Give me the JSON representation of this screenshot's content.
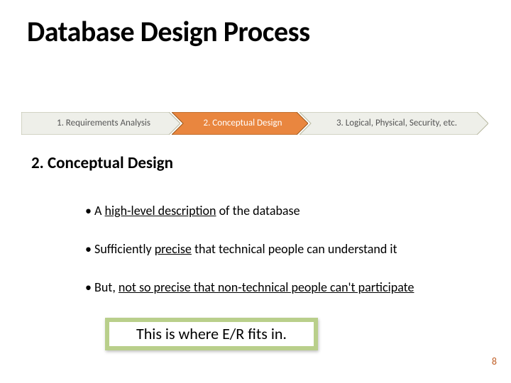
{
  "title": "Database Design Process",
  "chevrons": {
    "step1": "1. Requirements Analysis",
    "step2": "2. Conceptual Design",
    "step3": "3. Logical, Physical, Security, etc."
  },
  "subtitle": "2. Conceptual Design",
  "bullets": {
    "b1_pre": "A ",
    "b1_u": "high-level description",
    "b1_post": " of the database",
    "b2_pre": "Sufficiently ",
    "b2_u": "precise",
    "b2_post": " that technical people can understand it",
    "b3_pre": "But, ",
    "b3_u": "not so precise that non-technical people can't participate"
  },
  "callout": "This is where E/R fits in.",
  "pagenum": "8"
}
